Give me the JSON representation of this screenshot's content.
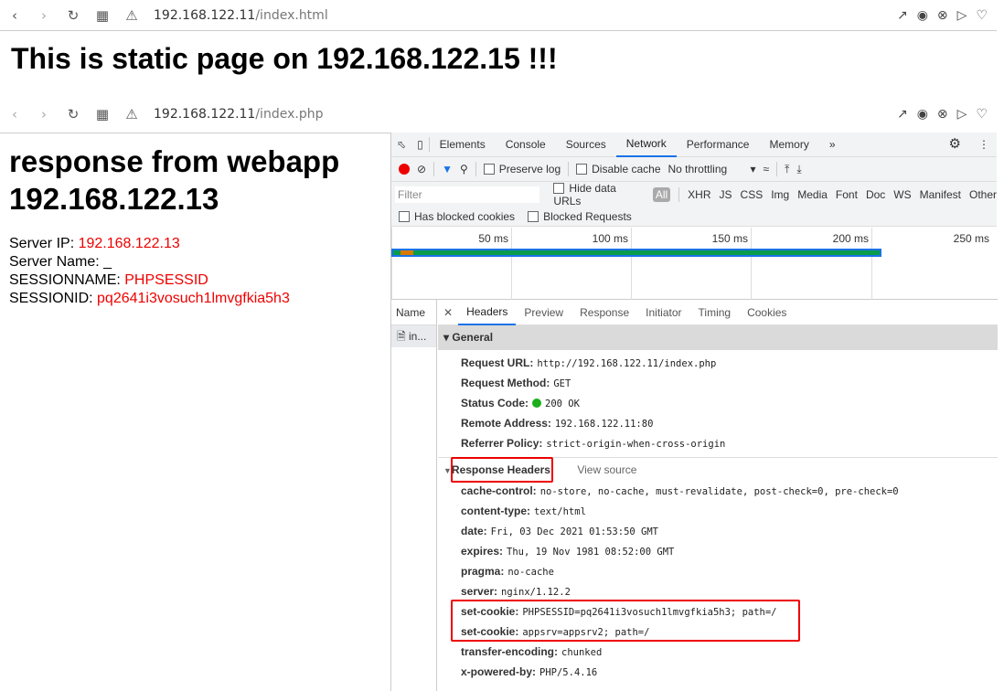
{
  "browser_top": {
    "url_host": "192.168.122.11",
    "url_path": "/index.html"
  },
  "static_heading": "This is static page on 192.168.122.15 !!!",
  "browser_inner": {
    "url_host": "192.168.122.11",
    "url_path": "/index.php"
  },
  "page": {
    "heading_line1": "response from webapp",
    "heading_line2": "192.168.122.13",
    "fields": [
      {
        "label": "Server IP: ",
        "value": "192.168.122.13"
      },
      {
        "label": "Server Name: _",
        "value": ""
      },
      {
        "label": "SESSIONNAME: ",
        "value": "PHPSESSID"
      },
      {
        "label": "SESSIONID: ",
        "value": "pq2641i3vosuch1lmvgfkia5h3"
      }
    ]
  },
  "devtools": {
    "tabs": [
      "Elements",
      "Console",
      "Sources",
      "Network",
      "Performance",
      "Memory"
    ],
    "active_tab": "Network",
    "toolbar": {
      "preserve_log": "Preserve log",
      "disable_cache": "Disable cache",
      "throttling": "No throttling"
    },
    "filter_placeholder": "Filter",
    "hide_data_urls": "Hide data URLs",
    "types": [
      "All",
      "XHR",
      "JS",
      "CSS",
      "Img",
      "Media",
      "Font",
      "Doc",
      "WS",
      "Manifest",
      "Other"
    ],
    "has_blocked_cookies": "Has blocked cookies",
    "blocked_requests": "Blocked Requests",
    "timeline_ticks": [
      "50 ms",
      "100 ms",
      "150 ms",
      "200 ms",
      "250 ms"
    ],
    "name_header": "Name",
    "request_name": "in...",
    "detail_tabs": [
      "Headers",
      "Preview",
      "Response",
      "Initiator",
      "Timing",
      "Cookies"
    ],
    "general_title": "General",
    "general": [
      {
        "k": "Request URL:",
        "v": "http://192.168.122.11/index.php"
      },
      {
        "k": "Request Method:",
        "v": "GET"
      },
      {
        "k": "Status Code:",
        "v": "200 OK"
      },
      {
        "k": "Remote Address:",
        "v": "192.168.122.11:80"
      },
      {
        "k": "Referrer Policy:",
        "v": "strict-origin-when-cross-origin"
      }
    ],
    "response_title": "Response Headers",
    "view_source": "View source",
    "response": [
      {
        "k": "cache-control:",
        "v": "no-store, no-cache, must-revalidate, post-check=0, pre-check=0"
      },
      {
        "k": "content-type:",
        "v": "text/html"
      },
      {
        "k": "date:",
        "v": "Fri, 03 Dec 2021 01:53:50 GMT"
      },
      {
        "k": "expires:",
        "v": "Thu, 19 Nov 1981 08:52:00 GMT"
      },
      {
        "k": "pragma:",
        "v": "no-cache"
      },
      {
        "k": "server:",
        "v": "nginx/1.12.2"
      },
      {
        "k": "set-cookie:",
        "v": "PHPSESSID=pq2641i3vosuch1lmvgfkia5h3; path=/"
      },
      {
        "k": "set-cookie:",
        "v": "appsrv=appsrv2; path=/"
      },
      {
        "k": "transfer-encoding:",
        "v": "chunked"
      },
      {
        "k": "x-powered-by:",
        "v": "PHP/5.4.16"
      }
    ]
  }
}
